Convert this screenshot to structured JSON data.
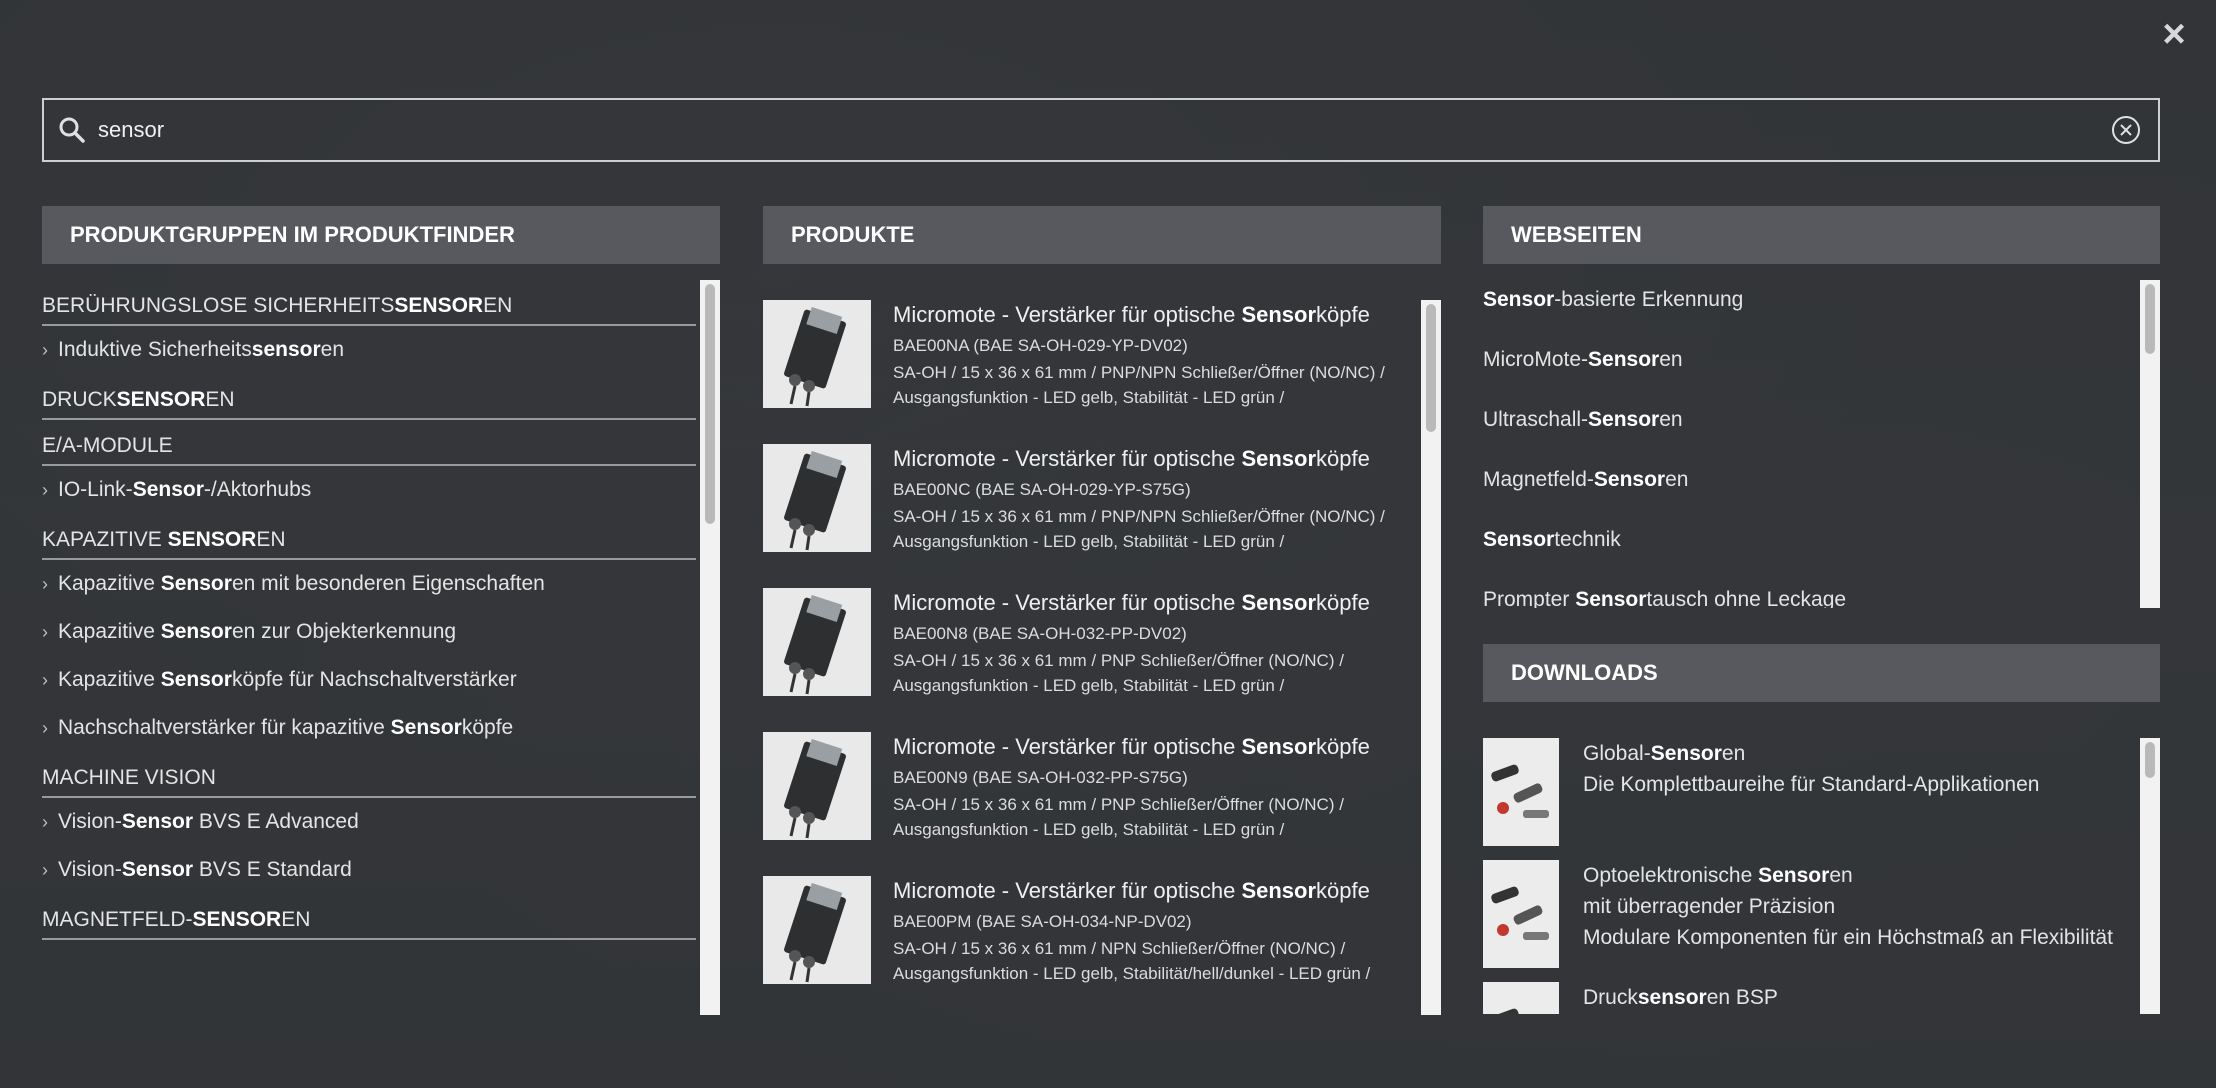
{
  "close_label": "×",
  "search": {
    "value": "sensor"
  },
  "groups": {
    "header": "PRODUKTGRUPPEN IM PRODUKTFINDER",
    "items": [
      {
        "type": "title",
        "pre": "BERÜHRUNGSLOSE SICHERHEITS",
        "bold": "SENSOR",
        "post": "EN"
      },
      {
        "type": "item",
        "pre": "Induktive Sicherheits",
        "bold": "sensor",
        "post": "en"
      },
      {
        "type": "title",
        "pre": "DRUCK",
        "bold": "SENSOR",
        "post": "EN"
      },
      {
        "type": "title",
        "pre": "E/A-MODULE",
        "bold": "",
        "post": ""
      },
      {
        "type": "item",
        "pre": "IO-Link-",
        "bold": "Sensor",
        "post": "-/Aktorhubs"
      },
      {
        "type": "title",
        "pre": "KAPAZITIVE ",
        "bold": "SENSOR",
        "post": "EN"
      },
      {
        "type": "item",
        "pre": "Kapazitive ",
        "bold": "Sensor",
        "post": "en mit besonderen Eigenschaften"
      },
      {
        "type": "item",
        "pre": "Kapazitive ",
        "bold": "Sensor",
        "post": "en zur Objekterkennung"
      },
      {
        "type": "item",
        "pre": "Kapazitive ",
        "bold": "Sensor",
        "post": "köpfe für Nachschaltverstärker"
      },
      {
        "type": "item",
        "pre": "Nachschaltverstärker für kapazitive ",
        "bold": "Sensor",
        "post": "köpfe"
      },
      {
        "type": "title",
        "pre": "MACHINE VISION",
        "bold": "",
        "post": ""
      },
      {
        "type": "item",
        "pre": "Vision-",
        "bold": "Sensor",
        "post": " BVS E Advanced"
      },
      {
        "type": "item",
        "pre": "Vision-",
        "bold": "Sensor",
        "post": " BVS E Standard"
      },
      {
        "type": "title",
        "pre": "MAGNETFELD-",
        "bold": "SENSOR",
        "post": "EN"
      }
    ]
  },
  "products": {
    "header": "PRODUKTE",
    "items": [
      {
        "title_pre": "Micromote - Verstärker für optische ",
        "title_bold": "Sensor",
        "title_post": "köpfe",
        "code": "BAE00NA (BAE SA-OH-029-YP-DV02)",
        "desc": "SA-OH / 15 x 36 x 61 mm / PNP/NPN Schließer/Öffner (NO/NC) / Ausgangsfunktion - LED gelb, Stabilität - LED grün /"
      },
      {
        "title_pre": "Micromote - Verstärker für optische ",
        "title_bold": "Sensor",
        "title_post": "köpfe",
        "code": "BAE00NC (BAE SA-OH-029-YP-S75G)",
        "desc": "SA-OH / 15 x 36 x 61 mm / PNP/NPN Schließer/Öffner (NO/NC) / Ausgangsfunktion - LED gelb, Stabilität - LED grün /"
      },
      {
        "title_pre": "Micromote - Verstärker für optische ",
        "title_bold": "Sensor",
        "title_post": "köpfe",
        "code": "BAE00N8 (BAE SA-OH-032-PP-DV02)",
        "desc": "SA-OH / 15 x 36 x 61 mm / PNP Schließer/Öffner (NO/NC) / Ausgangsfunktion - LED gelb, Stabilität - LED grün /"
      },
      {
        "title_pre": "Micromote - Verstärker für optische ",
        "title_bold": "Sensor",
        "title_post": "köpfe",
        "code": "BAE00N9 (BAE SA-OH-032-PP-S75G)",
        "desc": "SA-OH / 15 x 36 x 61 mm / PNP Schließer/Öffner (NO/NC) / Ausgangsfunktion - LED gelb, Stabilität - LED grün /"
      },
      {
        "title_pre": "Micromote - Verstärker für optische ",
        "title_bold": "Sensor",
        "title_post": "köpfe",
        "code": "BAE00PM (BAE SA-OH-034-NP-DV02)",
        "desc": "SA-OH / 15 x 36 x 61 mm / NPN Schließer/Öffner (NO/NC) / Ausgangsfunktion - LED gelb, Stabilität/hell/dunkel - LED grün /"
      }
    ]
  },
  "websites": {
    "header": "WEBSEITEN",
    "items": [
      {
        "pre": "",
        "bold": "Sensor",
        "post": "-basierte Erkennung"
      },
      {
        "pre": "MicroMote-",
        "bold": "Sensor",
        "post": "en"
      },
      {
        "pre": "Ultraschall-",
        "bold": "Sensor",
        "post": "en"
      },
      {
        "pre": "Magnetfeld-",
        "bold": "Sensor",
        "post": "en"
      },
      {
        "pre": "",
        "bold": "Sensor",
        "post": "technik"
      },
      {
        "pre": "Prompter ",
        "bold": "Sensor",
        "post": "tausch ohne Leckage"
      }
    ]
  },
  "downloads": {
    "header": "DOWNLOADS",
    "items": [
      {
        "line1_pre": "Global-",
        "line1_bold": "Sensor",
        "line1_post": "en",
        "line2": "Die Komplettbaureihe für Standard-Applikationen",
        "line3": ""
      },
      {
        "line1_pre": "Optoelektronische ",
        "line1_bold": "Sensor",
        "line1_post": "en",
        "line2": "mit überragender Präzision",
        "line3": "Modulare Komponenten für ein Höchstmaß an Flexibilität"
      },
      {
        "line1_pre": "Druck",
        "line1_bold": "sensor",
        "line1_post": "en BSP",
        "line2": "",
        "line3": ""
      }
    ]
  }
}
